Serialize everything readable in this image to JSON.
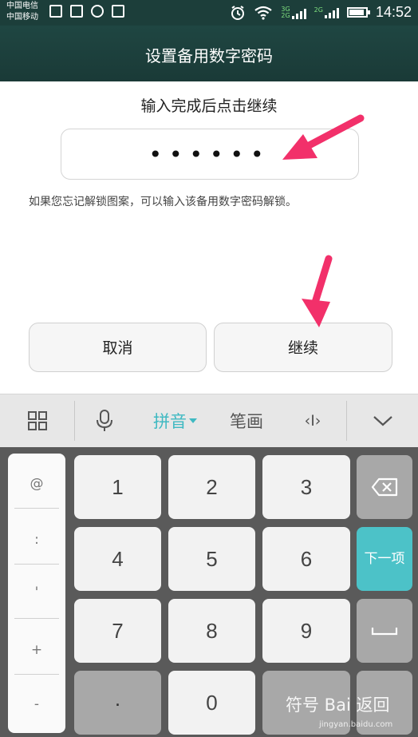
{
  "status_bar": {
    "carrier_1": "中国电信",
    "carrier_2": "中国移动",
    "net_3g": "3G",
    "net_2g": "2G",
    "net_2g_b": "2G",
    "time": "14:52"
  },
  "header": {
    "title": "设置备用数字密码"
  },
  "instruction": "输入完成后点击继续",
  "password_field": {
    "masked_value": "••••••"
  },
  "hint": "如果您忘记解锁图案，可以输入该备用数字密码解锁。",
  "buttons": {
    "cancel": "取消",
    "continue": "继续"
  },
  "keyboard_toolbar": {
    "pinyin": "拼音",
    "stroke": "笔画",
    "cursor": "‹I›"
  },
  "symbols": [
    "@",
    ":",
    "'",
    "+",
    "-"
  ],
  "digit_keys": [
    "1",
    "2",
    "3",
    "4",
    "5",
    "6",
    "7",
    "8",
    "9",
    ".",
    "0"
  ],
  "function_keys": {
    "next": "下一项"
  },
  "colors": {
    "header_bg": "#1c3e3a",
    "accent_teal": "#4cc2c8",
    "arrow_pink": "#f2306a",
    "keyboard_bg": "#5a5a5a"
  },
  "icons": [
    "grid-icon",
    "microphone-icon",
    "chevron-down-icon",
    "backspace-icon",
    "space-icon",
    "alarm-icon",
    "wifi-icon",
    "battery-icon"
  ],
  "watermark": {
    "text": "符号 Bai 返回",
    "sub": "jingyan.baidu.com"
  }
}
